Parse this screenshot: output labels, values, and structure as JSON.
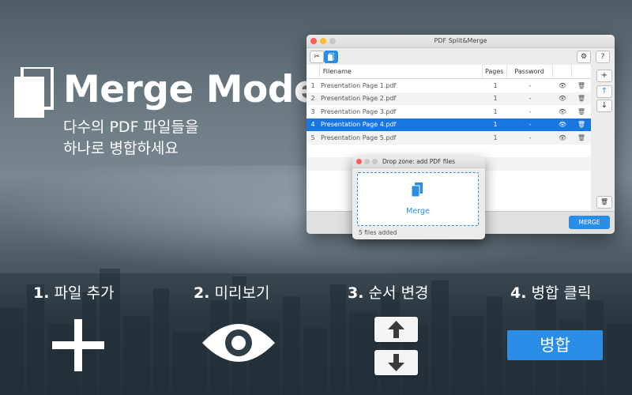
{
  "hero": {
    "title": "Merge Mode",
    "subtitle": "다수의 PDF 파일들을\n하나로 병합하세요"
  },
  "window": {
    "title": "PDF Split&Merge",
    "toolbar": {
      "left_buttons": [
        "scissors-icon",
        "pages-icon"
      ],
      "right_buttons": [
        "gear-icon",
        "help-icon"
      ],
      "help_label": "?"
    },
    "columns": [
      "Filename",
      "Pages",
      "Password"
    ],
    "rows": [
      {
        "num": "1",
        "name": "Presentation Page 1.pdf",
        "pages": "1",
        "password": "-"
      },
      {
        "num": "2",
        "name": "Presentation Page 2.pdf",
        "pages": "1",
        "password": "-"
      },
      {
        "num": "3",
        "name": "Presentation Page 3.pdf",
        "pages": "1",
        "password": "-"
      },
      {
        "num": "4",
        "name": "Presentation Page 4.pdf",
        "pages": "1",
        "password": "-"
      },
      {
        "num": "5",
        "name": "Presentation Page 5.pdf",
        "pages": "1",
        "password": "-"
      }
    ],
    "selected_row": "4",
    "side_buttons": [
      "+",
      "↑",
      "↓"
    ],
    "merge_label": "MERGE"
  },
  "drop": {
    "title": "Drop zone: add PDF files",
    "label": "Merge",
    "status": "5 files added"
  },
  "steps": [
    {
      "num": "1.",
      "text": "파일 추가"
    },
    {
      "num": "2.",
      "text": "미리보기"
    },
    {
      "num": "3.",
      "text": "순서 변경"
    },
    {
      "num": "4.",
      "text": "병합 클릭"
    }
  ],
  "merge_big_label": "병합",
  "colors": {
    "accent": "#2a8de6",
    "selection": "#1877e0"
  }
}
